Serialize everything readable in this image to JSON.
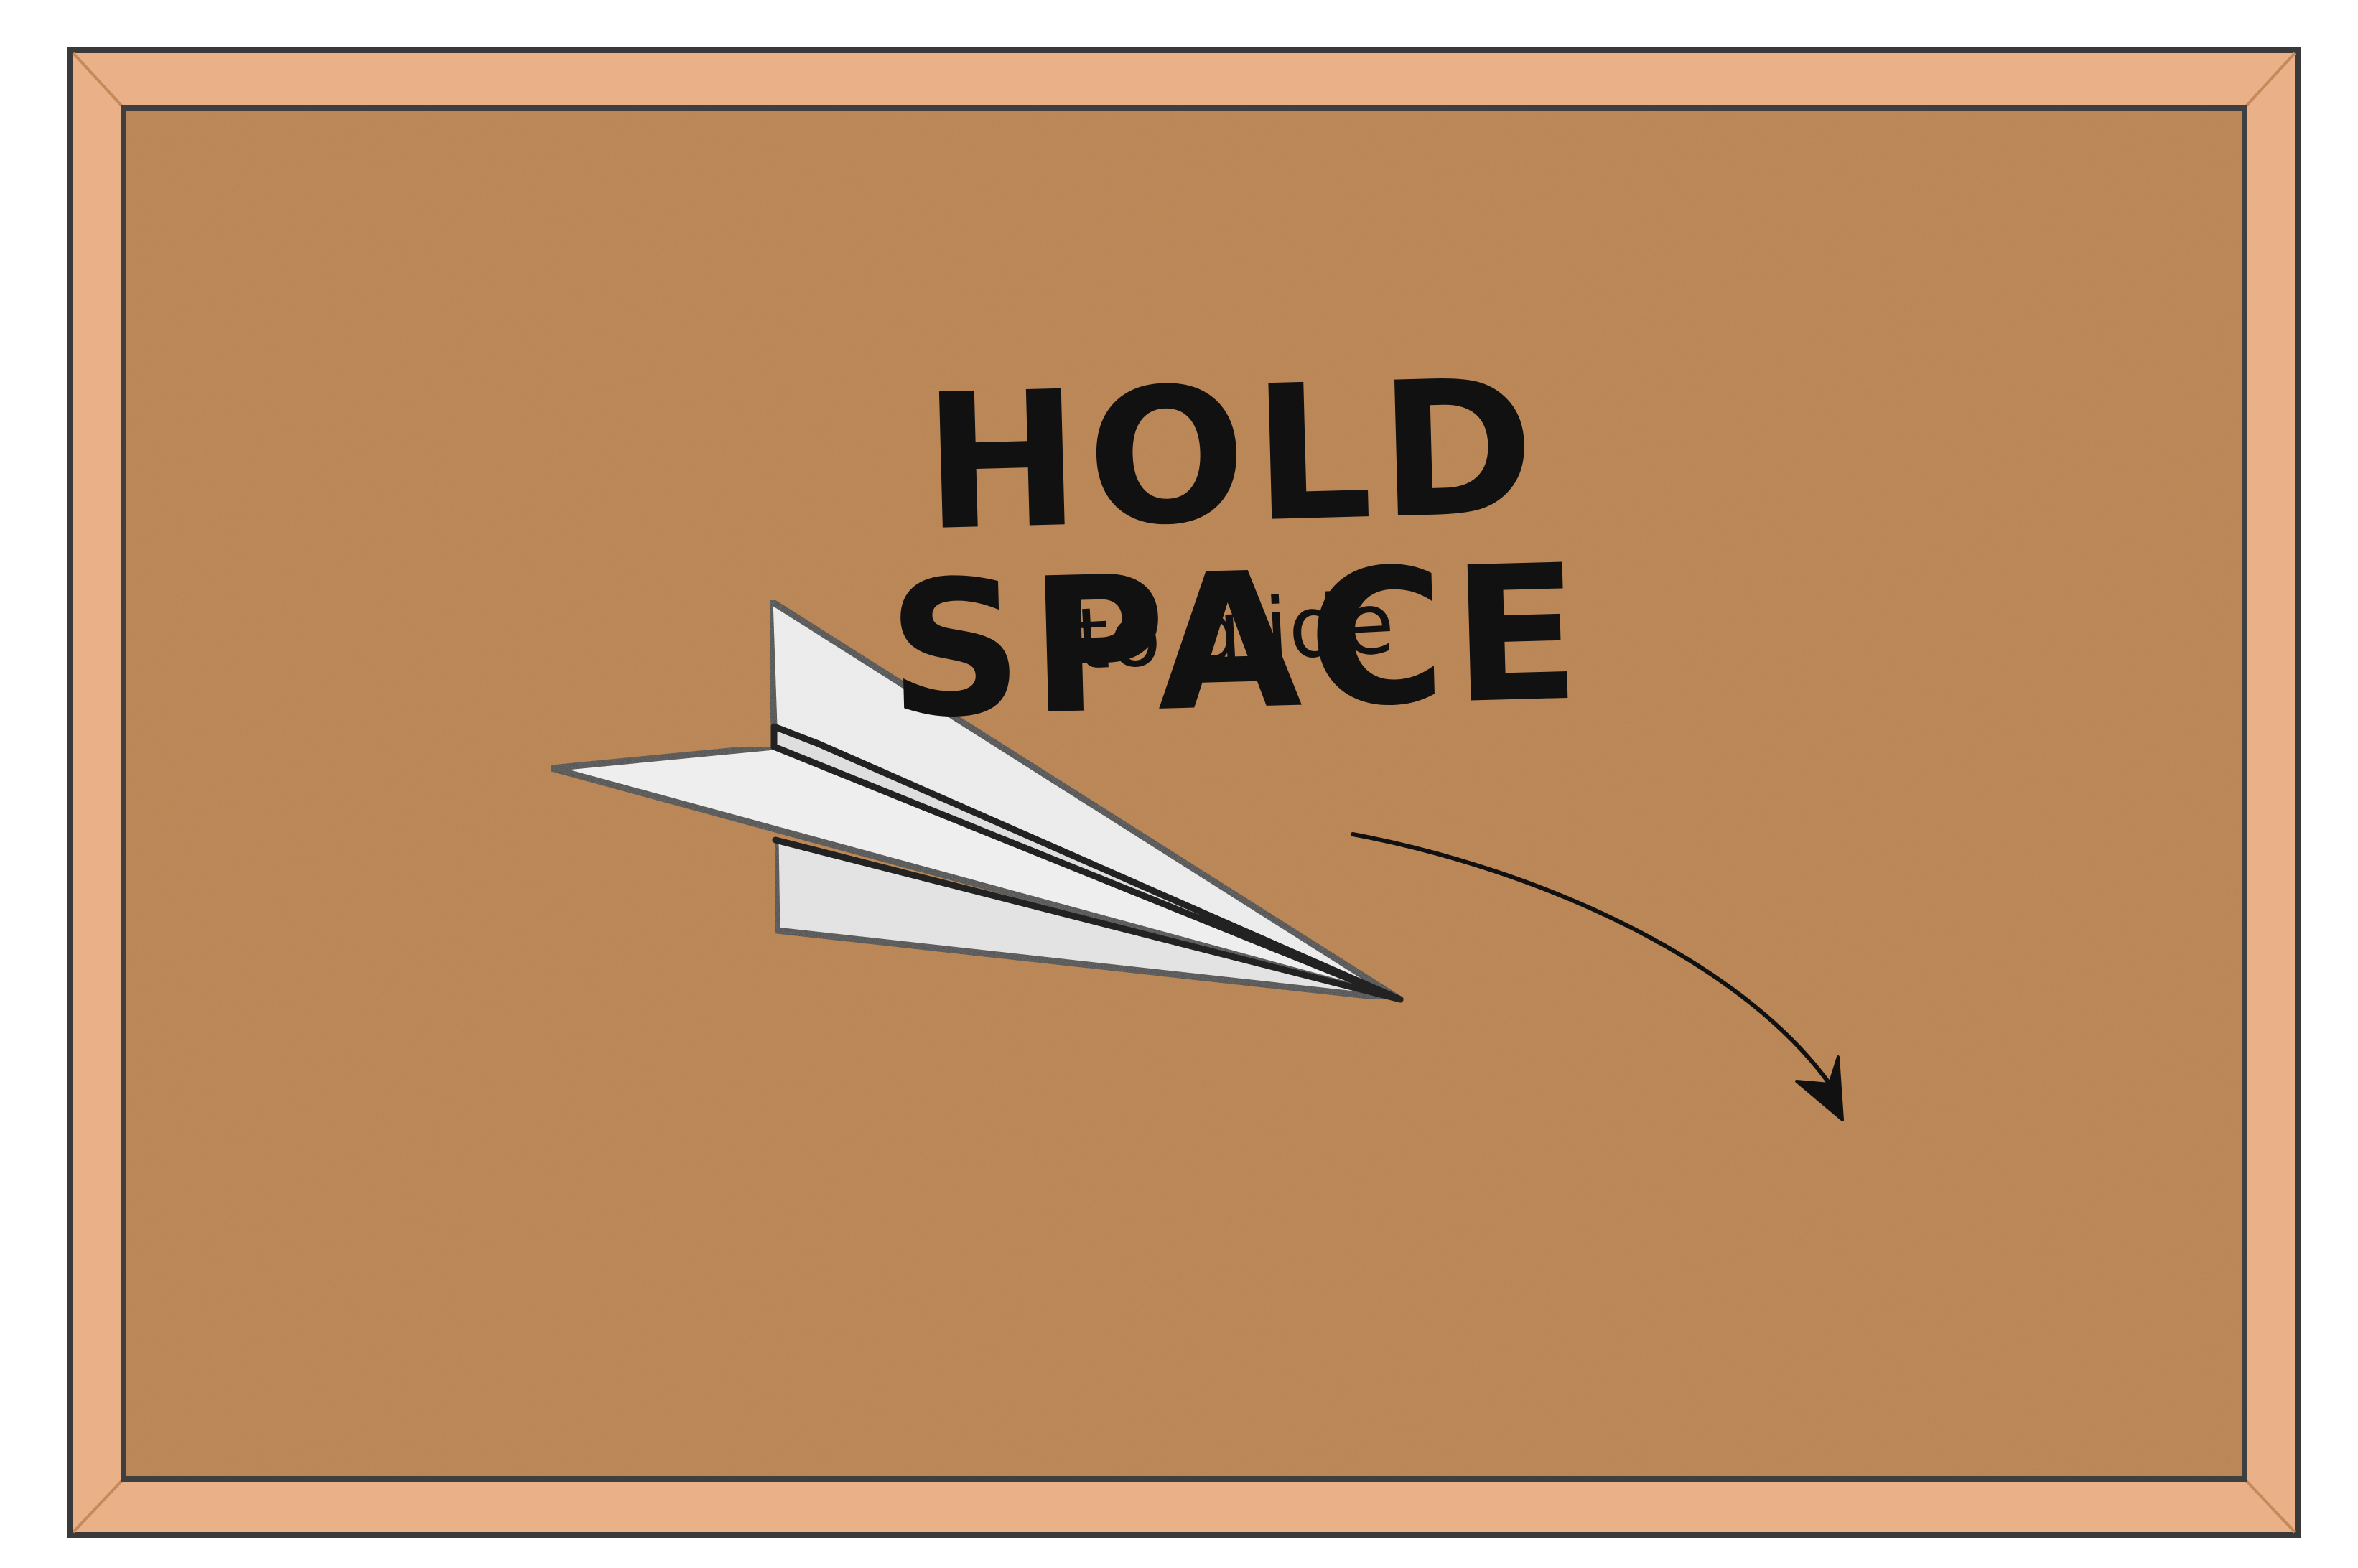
{
  "instruction": {
    "headline": "HOLD SPACE",
    "subline": "to glide"
  },
  "colors": {
    "frame_wood": "#eab189",
    "frame_wood_dark": "#d49a6d",
    "cork": "#c48a59",
    "ink": "#111111",
    "paper": "#eeeeee"
  },
  "icons": {
    "board": "corkboard",
    "plane": "paper-airplane-icon",
    "arrow": "curved-arrow-icon"
  }
}
